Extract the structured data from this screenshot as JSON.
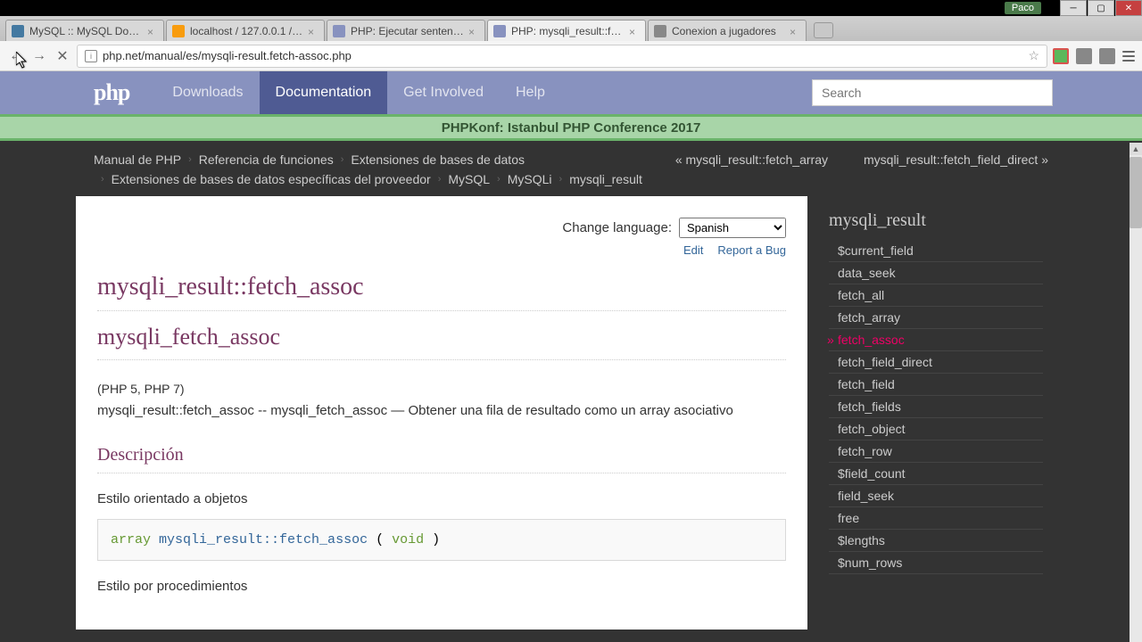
{
  "window": {
    "user": "Paco",
    "tabs": [
      {
        "title": "MySQL :: MySQL Downlo",
        "favicon": "mysql"
      },
      {
        "title": "localhost / 127.0.0.1 / eq",
        "favicon": "pma"
      },
      {
        "title": "PHP: Ejecutar sentencias",
        "favicon": "php"
      },
      {
        "title": "PHP: mysqli_result::fetch",
        "favicon": "php"
      },
      {
        "title": "Conexion a jugadores",
        "favicon": "none"
      }
    ],
    "active_tab": 3,
    "url": "php.net/manual/es/mysqli-result.fetch-assoc.php"
  },
  "header": {
    "logo": "php",
    "nav": [
      "Downloads",
      "Documentation",
      "Get Involved",
      "Help"
    ],
    "nav_active": 1,
    "search_placeholder": "Search"
  },
  "announcement": "PHPKonf: Istanbul PHP Conference 2017",
  "breadcrumbs": {
    "items": [
      "Manual de PHP",
      "Referencia de funciones",
      "Extensiones de bases de datos",
      "Extensiones de bases de datos específicas del proveedor",
      "MySQL",
      "MySQLi",
      "mysqli_result"
    ],
    "prev": "« mysqli_result::fetch_array",
    "next": "mysqli_result::fetch_field_direct »"
  },
  "page": {
    "change_language_label": "Change language:",
    "language": "Spanish",
    "edit_label": "Edit",
    "bug_label": "Report a Bug",
    "title_oop": "mysqli_result::fetch_assoc",
    "title_proc": "mysqli_fetch_assoc",
    "version": "(PHP 5, PHP 7)",
    "summary": "mysqli_result::fetch_assoc -- mysqli_fetch_assoc — Obtener una fila de resultado como un array asociativo",
    "section_desc": "Descripción",
    "style_oop": "Estilo orientado a objetos",
    "style_proc": "Estilo por procedimientos",
    "signature": {
      "return": "array",
      "method": "mysqli_result::fetch_assoc",
      "params": "void"
    }
  },
  "sidebar": {
    "title": "mysqli_result",
    "current": "fetch_assoc",
    "items": [
      "$current_field",
      "data_seek",
      "fetch_all",
      "fetch_array",
      "fetch_assoc",
      "fetch_field_direct",
      "fetch_field",
      "fetch_fields",
      "fetch_object",
      "fetch_row",
      "$field_count",
      "field_seek",
      "free",
      "$lengths",
      "$num_rows"
    ]
  }
}
